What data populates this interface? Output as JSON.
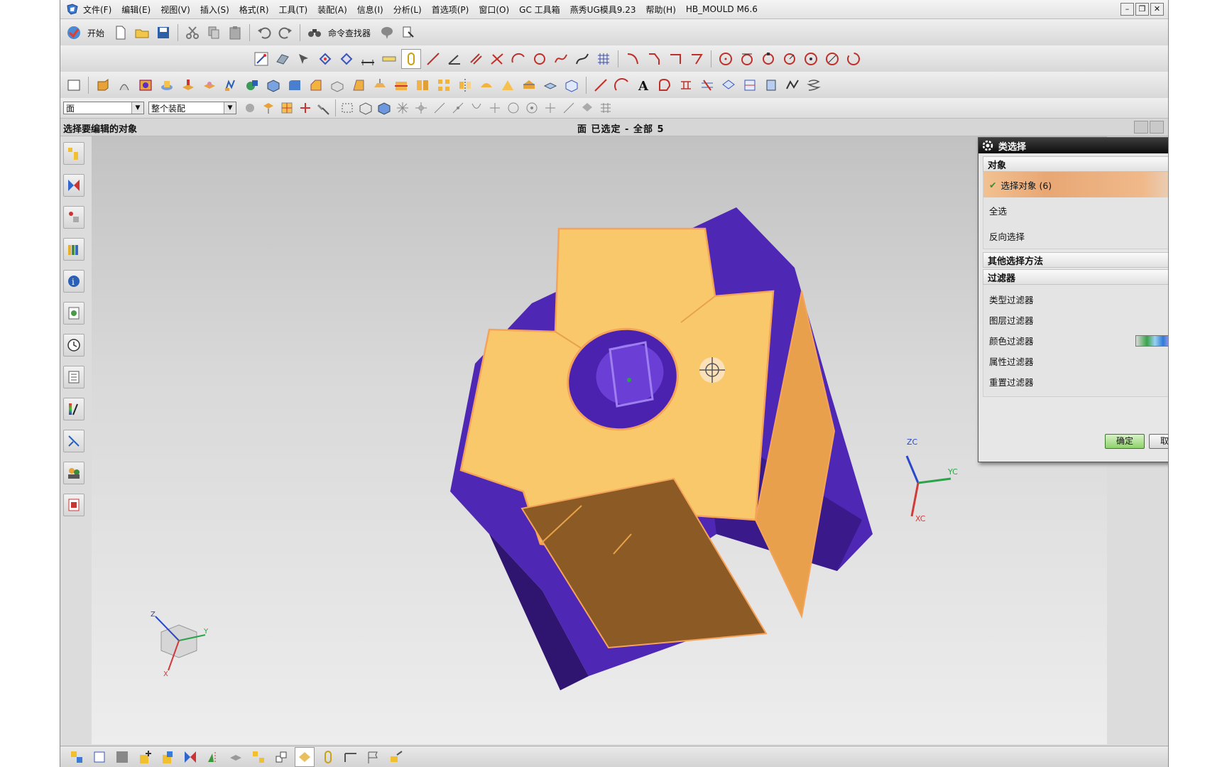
{
  "menubar": {
    "items": [
      "文件(F)",
      "编辑(E)",
      "视图(V)",
      "插入(S)",
      "格式(R)",
      "工具(T)",
      "装配(A)",
      "信息(I)",
      "分析(L)",
      "首选项(P)",
      "窗口(O)",
      "GC 工具箱",
      "燕秀UG模具9.23",
      "帮助(H)",
      "HB_MOULD M6.6"
    ]
  },
  "toolbar": {
    "start_label": "开始",
    "command_finder_label": "命令查找器"
  },
  "filterbar": {
    "type_filter": "面",
    "scope_filter": "整个装配"
  },
  "status": {
    "prompt": "选择要编辑的对象",
    "selection_info": "面 已选定 - 全部 5"
  },
  "dialog": {
    "title": "类选择",
    "section_object": "对象",
    "select_objects_label": "选择对象 (6)",
    "select_all_label": "全选",
    "invert_selection_label": "反向选择",
    "section_other_methods": "其他选择方法",
    "section_filter": "过滤器",
    "type_filter_label": "类型过滤器",
    "layer_filter_label": "图层过滤器",
    "color_filter_label": "颜色过滤器",
    "attribute_filter_label": "属性过滤器",
    "reset_filter_label": "重置过滤器",
    "ok_label": "确定",
    "cancel_label": "取消"
  },
  "triad": {
    "zc": "ZC",
    "yc": "YC",
    "xc": "XC",
    "z": "Z",
    "y": "Y",
    "x": "X"
  },
  "colors": {
    "face_yellow": "#f9c86a",
    "face_orange": "#e9a04d",
    "face_brown": "#8c5a25",
    "body_purple": "#5a2fc4",
    "body_dark_purple": "#34166f",
    "selection_highlight": "#f5a35a",
    "dialog_title_bg": "#111111"
  }
}
